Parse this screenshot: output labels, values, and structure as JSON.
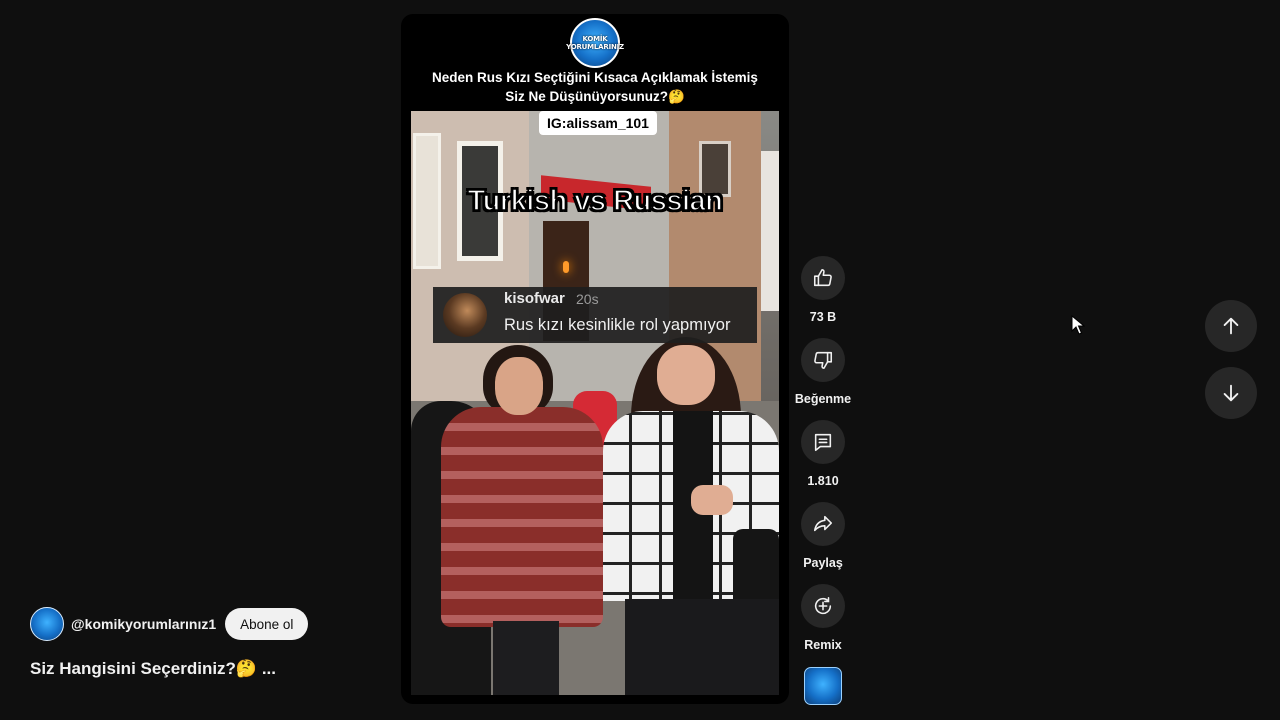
{
  "video": {
    "logo_text": "KOMİK YORUMLARINIZ",
    "title_line1": "Neden Rus Kızı Seçtiğini Kısaca Açıklamak İstemiş",
    "title_line2": "Siz Ne Düşünüyorsunuz?🤔",
    "ig_tag": "IG:alissam_101",
    "overlay_title": "Turkish vs Russian",
    "comment": {
      "username": "kisofwar",
      "time": "20s",
      "text": "Rus kızı kesinlikle rol yapmıyor"
    }
  },
  "actions": {
    "like_count": "73 B",
    "dislike_label": "Beğenme",
    "comment_count": "1.810",
    "share_label": "Paylaş",
    "remix_label": "Remix"
  },
  "channel": {
    "handle": "@komikyorumlarınız1",
    "subscribe_label": "Abone ol",
    "short_title": "Siz Hangisini Seçerdiniz?🤔 ..."
  },
  "icons": {
    "like": "thumb-up-icon",
    "dislike": "thumb-down-icon",
    "comments": "comment-icon",
    "share": "share-icon",
    "remix": "remix-icon",
    "previous": "arrow-up-icon",
    "next": "arrow-down-icon"
  },
  "colors": {
    "background": "#0f0f0f",
    "button_bg": "#272727",
    "subscribe_bg": "#f1f1f1",
    "text": "#f1f1f1"
  }
}
